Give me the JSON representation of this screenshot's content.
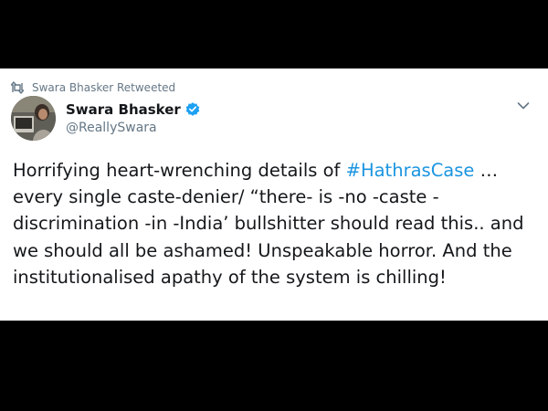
{
  "colors": {
    "background": "#000000",
    "card": "#ffffff",
    "text": "#14171a",
    "secondary": "#657786",
    "link": "#1b95e0",
    "verified": "#1da1f2"
  },
  "retweet": {
    "icon": "retweet-icon",
    "label": "Swara Bhasker Retweeted"
  },
  "author": {
    "display_name": "Swara Bhasker",
    "handle": "@ReallySwara",
    "verified_icon": "verified-badge-icon"
  },
  "menu": {
    "icon": "chevron-down-icon"
  },
  "tweet": {
    "text_before": "Horrifying heart-wrenching details of ",
    "hashtag": "#HathrasCase",
    "text_after": " … every single caste-denier/ “there- is -no -caste -discrimination -in -India’ bullshitter should read this.. and we should all be ashamed! Unspeakable horror. And the institutionalised apathy of the system is chilling!"
  }
}
